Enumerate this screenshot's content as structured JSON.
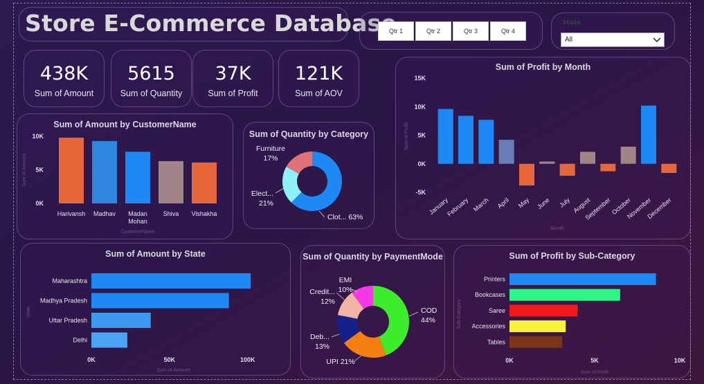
{
  "title": "Store E-Commerce Database",
  "quarters": [
    "Qtr 1",
    "Qtr 2",
    "Qtr 3",
    "Qtr 4"
  ],
  "state_filter": {
    "label": "State",
    "value": "All"
  },
  "kpis": [
    {
      "value": "438K",
      "label": "Sum of Amount"
    },
    {
      "value": "5615",
      "label": "Sum of Quantity"
    },
    {
      "value": "37K",
      "label": "Sum of Profit"
    },
    {
      "value": "121K",
      "label": "Sum of AOV"
    }
  ],
  "colors": {
    "blue": "#1e88f5",
    "orange": "#e8673a",
    "gray": "#a08488"
  },
  "chart_data": [
    {
      "id": "amount_by_customer",
      "type": "bar",
      "title": "Sum of Amount by CustomerName",
      "xlabel": "CustomerName",
      "ylabel": "Sum of Amount",
      "categories": [
        "Harivansh",
        "Madhav",
        "Madan Mohan",
        "Shiva",
        "Vishakha"
      ],
      "values": [
        9800,
        9300,
        7700,
        6300,
        6100
      ],
      "ylim": [
        0,
        10000
      ],
      "yticks": [
        "0K",
        "5K",
        "10K"
      ],
      "colors": [
        "#e8673a",
        "#2e86de",
        "#1e88f5",
        "#a08488",
        "#e8673a"
      ]
    },
    {
      "id": "quantity_by_category",
      "type": "pie",
      "title": "Sum of Quantity by Category",
      "categories": [
        "Clothing",
        "Electronics",
        "Furniture"
      ],
      "labels": [
        "Clot... 63%",
        "Elect... 21%",
        "Furniture 17%"
      ],
      "values": [
        63,
        21,
        17
      ],
      "colors": [
        "#1e88f5",
        "#8ef0f8",
        "#e0737a"
      ]
    },
    {
      "id": "profit_by_month",
      "type": "bar",
      "title": "Sum of Profit by Month",
      "xlabel": "Month",
      "ylabel": "Sum of Profit",
      "categories": [
        "January",
        "February",
        "March",
        "April",
        "May",
        "June",
        "July",
        "August",
        "September",
        "October",
        "November",
        "December"
      ],
      "values": [
        9600,
        8400,
        7700,
        4200,
        -3800,
        400,
        -2100,
        2100,
        -1300,
        3000,
        10200,
        -1600
      ],
      "ylim": [
        -5000,
        15000
      ],
      "yticks": [
        "-5K",
        "0K",
        "5K",
        "10K",
        "15K"
      ],
      "colors": [
        "#1e88f5",
        "#1e88f5",
        "#1e88f5",
        "#6a7cb8",
        "#e8673a",
        "#a08488",
        "#e8673a",
        "#a08488",
        "#e8673a",
        "#a08488",
        "#1e88f5",
        "#e8673a"
      ]
    },
    {
      "id": "amount_by_state",
      "type": "bar",
      "orientation": "horizontal",
      "title": "Sum of Amount by State",
      "xlabel": "Sum of Amount",
      "ylabel": "State",
      "categories": [
        "Maharashtra",
        "Madhya Pradesh",
        "Uttar Pradesh",
        "Delhi"
      ],
      "values": [
        102000,
        88000,
        38000,
        23000
      ],
      "xlim": [
        0,
        105000
      ],
      "xticks": [
        "0K",
        "50K",
        "100K"
      ],
      "colors": [
        "#1e88f5",
        "#1e88f5",
        "#3f98f0",
        "#4aa4f5"
      ]
    },
    {
      "id": "quantity_by_paymentmode",
      "type": "pie",
      "title": "Sum of Quantity by PaymentMode",
      "categories": [
        "COD",
        "UPI",
        "Debit Card",
        "Credit Card",
        "EMI"
      ],
      "labels": [
        "COD 44%",
        "UPI 21%",
        "Deb... 13%",
        "Credit... 12%",
        "EMI 10%"
      ],
      "values": [
        44,
        21,
        13,
        12,
        10
      ],
      "colors": [
        "#3ded2c",
        "#f67f12",
        "#16208a",
        "#f2b2a4",
        "#f738e6"
      ]
    },
    {
      "id": "profit_by_subcategory",
      "type": "bar",
      "orientation": "horizontal",
      "title": "Sum of Profit by Sub-Category",
      "xlabel": "Sum of Profit",
      "ylabel": "Sub-Category",
      "categories": [
        "Printers",
        "Bookcases",
        "Saree",
        "Accessories",
        "Tables"
      ],
      "values": [
        8600,
        6500,
        4000,
        3300,
        3100
      ],
      "xlim": [
        0,
        10000
      ],
      "xticks": [
        "0K",
        "5K",
        "10K"
      ],
      "colors": [
        "#1e88f5",
        "#2ef585",
        "#f21a1a",
        "#f6f33a",
        "#7a3518"
      ]
    }
  ]
}
